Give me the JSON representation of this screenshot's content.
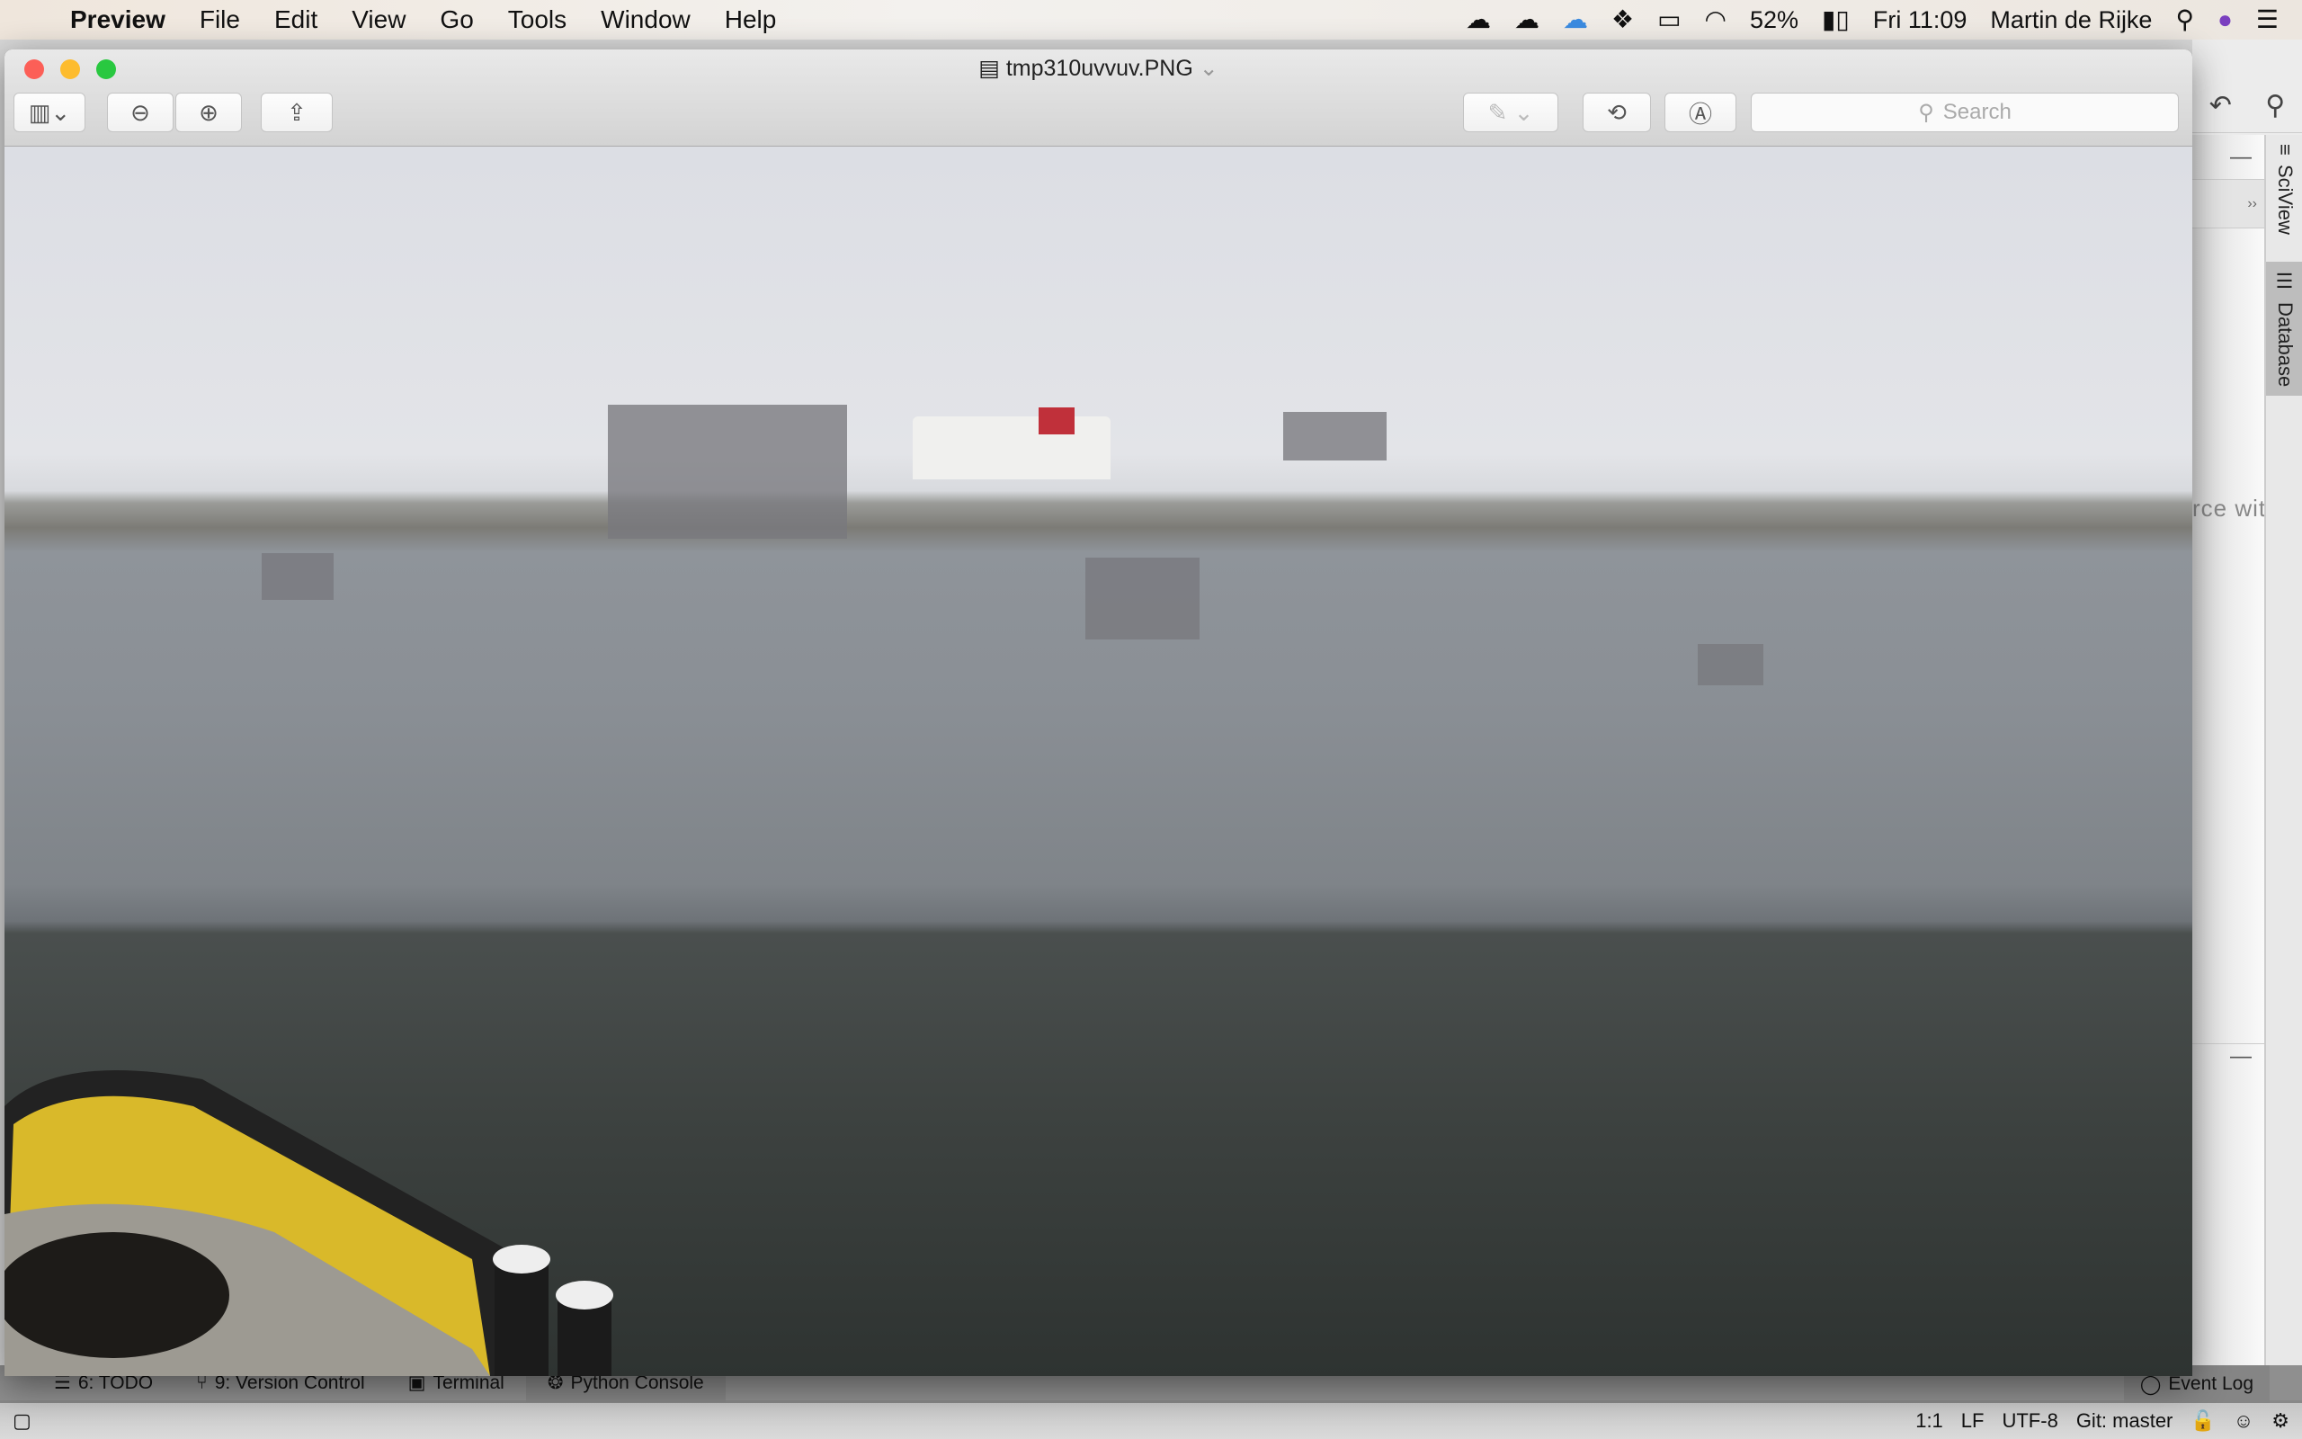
{
  "menubar": {
    "apple": "",
    "app": "Preview",
    "items": [
      "File",
      "Edit",
      "View",
      "Go",
      "Tools",
      "Window",
      "Help"
    ],
    "battery": "52%",
    "clock": "Fri 11:09",
    "user": "Martin de Rijke"
  },
  "window": {
    "title": "tmp310uvvuv.PNG",
    "search_placeholder": "Search"
  },
  "ide": {
    "panel_text": "rce with",
    "tabs": [
      "SciView",
      "Database"
    ],
    "toolwindows": [
      "6: TODO",
      "9: Version Control",
      "Terminal",
      "Python Console"
    ],
    "event_log": "Event Log",
    "status": {
      "position": "1:1",
      "line_sep": "LF",
      "encoding": "UTF-8",
      "vcs": "Git: master"
    }
  }
}
